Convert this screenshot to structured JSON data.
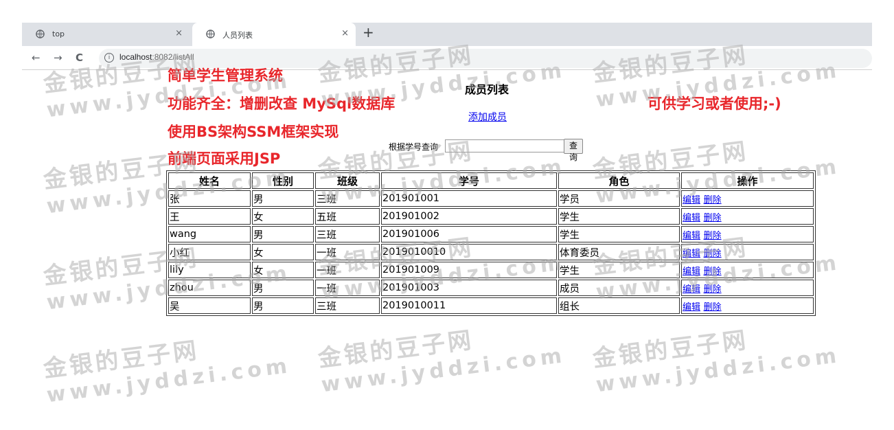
{
  "browser": {
    "tabs": [
      {
        "title": "top"
      },
      {
        "title": "人员列表"
      }
    ],
    "close_glyph": "×",
    "new_tab_glyph": "+",
    "nav": {
      "back": "←",
      "forward": "→",
      "reload": "C"
    },
    "url_host": "localhost",
    "url_path": ":8082/listAll"
  },
  "overlay": {
    "line1": "简单学生管理系统",
    "line2": "功能齐全：增删改查  MySql数据库",
    "line3": "使用BS架构SSM框架实现",
    "line4": "前端页面采用JSP",
    "right_note": "可供学习或者使用;-)"
  },
  "page": {
    "title": "成员列表",
    "add_link": "添加成员",
    "search_label": "根据学号查询",
    "search_value": "",
    "search_button": "查询"
  },
  "table": {
    "headers": [
      "姓名",
      "性别",
      "班级",
      "学号",
      "角色",
      "操作"
    ],
    "edit_label": "编辑",
    "delete_label": "删除",
    "rows": [
      {
        "name": "张",
        "gender": "男",
        "class": "三班",
        "id": "201901001",
        "role": "学员"
      },
      {
        "name": "王",
        "gender": "女",
        "class": "五班",
        "id": "201901002",
        "role": "学生"
      },
      {
        "name": "wang",
        "gender": "男",
        "class": "三班",
        "id": "201901006",
        "role": "学生"
      },
      {
        "name": "小红",
        "gender": "女",
        "class": "一班",
        "id": "2019010010",
        "role": "体育委员"
      },
      {
        "name": "lily",
        "gender": "女",
        "class": "一班",
        "id": "201901009",
        "role": "学生"
      },
      {
        "name": "zhou",
        "gender": "男",
        "class": "一班",
        "id": "201901003",
        "role": "成员"
      },
      {
        "name": "吴",
        "gender": "男",
        "class": "三班",
        "id": "2019010011",
        "role": "组长"
      }
    ]
  },
  "watermark": {
    "cn": "金银的豆子网",
    "en": "www.jyddzi.com"
  },
  "colors": {
    "accent_red": "#e8262b",
    "link_blue": "#0000ee",
    "tabstrip": "#dee1e6"
  }
}
